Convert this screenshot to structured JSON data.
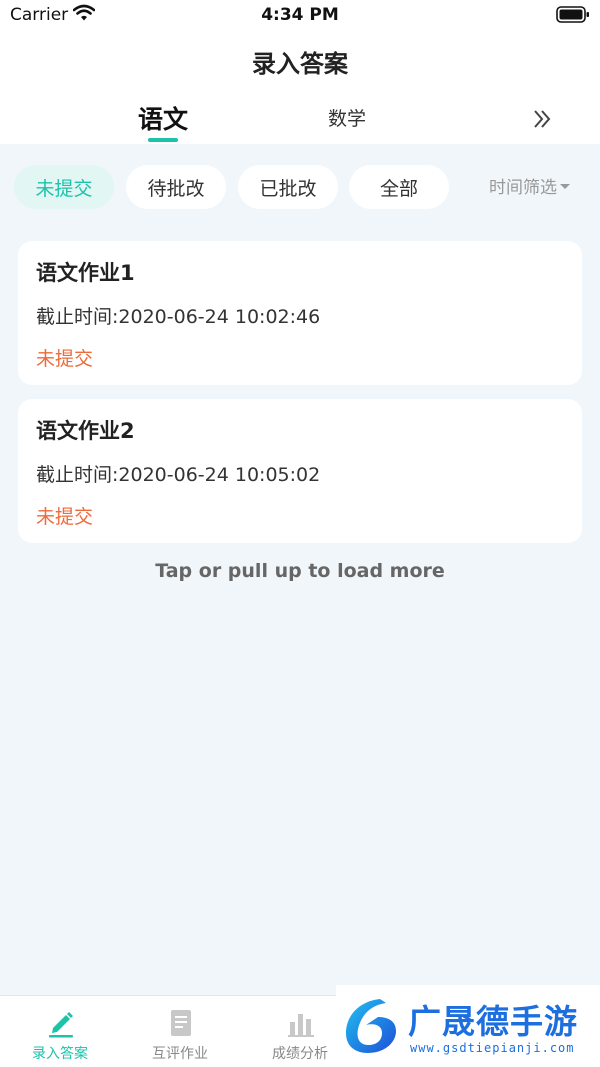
{
  "status_bar": {
    "carrier": "Carrier",
    "time": "4:34 PM"
  },
  "nav": {
    "title": "录入答案"
  },
  "subject_tabs": [
    {
      "label": "语文",
      "selected": true
    },
    {
      "label": "数学",
      "selected": false
    }
  ],
  "filters": {
    "chips": [
      {
        "label": "未提交",
        "selected": true
      },
      {
        "label": "待批改",
        "selected": false
      },
      {
        "label": "已批改",
        "selected": false
      },
      {
        "label": "全部",
        "selected": false
      }
    ],
    "time_filter": "时间筛选"
  },
  "assignments": [
    {
      "title": "语文作业1",
      "deadline": "截止时间:2020-06-24 10:02:46",
      "status": "未提交"
    },
    {
      "title": "语文作业2",
      "deadline": "截止时间:2020-06-24 10:05:02",
      "status": "未提交"
    }
  ],
  "load_more": "Tap or pull up to load more",
  "tabbar": [
    {
      "label": "录入答案",
      "icon": "pencil-icon",
      "active": true
    },
    {
      "label": "互评作业",
      "icon": "document-icon",
      "active": false
    },
    {
      "label": "成绩分析",
      "icon": "bar-chart-icon",
      "active": false
    }
  ],
  "watermark": {
    "text": "广晟德手游",
    "url": "www.gsdtiepianji.com"
  },
  "colors": {
    "accent": "#1cc3a9",
    "status_pending": "#ef6a3a",
    "background": "#f1f6fa"
  }
}
